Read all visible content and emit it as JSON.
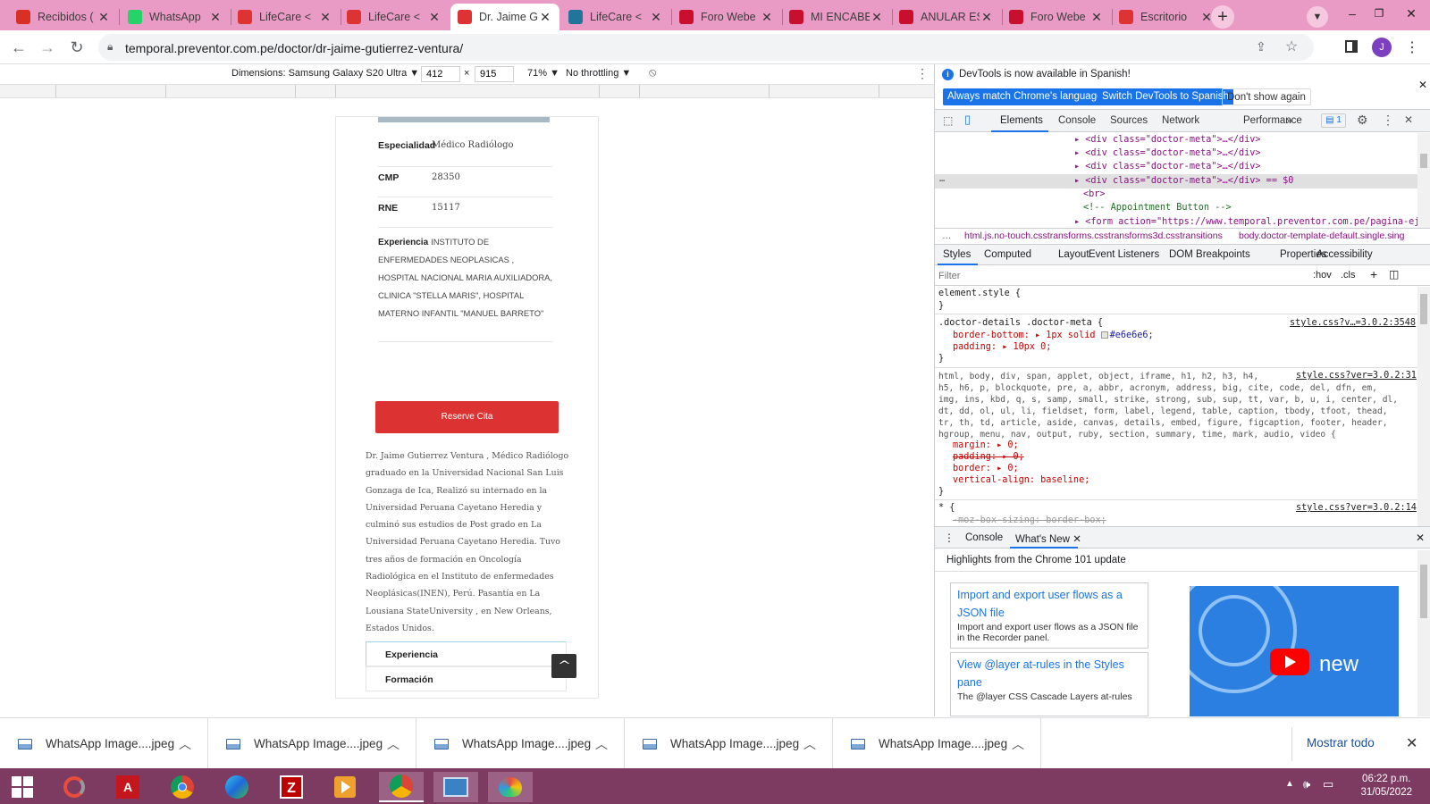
{
  "browser": {
    "tabs": [
      {
        "title": "Recibidos (",
        "favicon": "gmail-icon",
        "color": "#d93025"
      },
      {
        "title": "WhatsApp",
        "favicon": "whatsapp-icon",
        "color": "#25d366"
      },
      {
        "title": "LifeCare <",
        "favicon": "lifecare-icon",
        "color": "#d33"
      },
      {
        "title": "LifeCare <",
        "favicon": "lifecare-icon",
        "color": "#d33"
      },
      {
        "title": "Dr. Jaime G",
        "favicon": "lifecare-icon",
        "color": "#d33"
      },
      {
        "title": "LifeCare <",
        "favicon": "wordpress-icon",
        "color": "#21759b"
      },
      {
        "title": "Foro Webe",
        "favicon": "w-icon",
        "color": "#c8102e"
      },
      {
        "title": "MI ENCABE",
        "favicon": "w-icon",
        "color": "#c8102e"
      },
      {
        "title": "ANULAR ES",
        "favicon": "w-icon",
        "color": "#c8102e"
      },
      {
        "title": "Foro Webe",
        "favicon": "w-icon",
        "color": "#c8102e"
      },
      {
        "title": "Escritorio",
        "favicon": "lifecare-icon",
        "color": "#d33"
      }
    ],
    "url": "temporal.preventor.com.pe/doctor/dr-jaime-gutierrez-ventura/",
    "profile_initial": "J"
  },
  "device_toolbar": {
    "dimensions_label": "Dimensions: Samsung Galaxy S20 Ultra ▼",
    "width": "412",
    "times": "×",
    "height": "915",
    "zoom": "71% ▼",
    "throttling": "No throttling ▼"
  },
  "doctor_page": {
    "meta": [
      {
        "key": "Especialidad",
        "value": "Médico Radiólogo"
      },
      {
        "key": "CMP",
        "value": "28350"
      },
      {
        "key": "RNE",
        "value": "15117"
      }
    ],
    "experience_key": "Experiencia",
    "experience_value": "INSTITUTO DE ENFERMEDADES NEOPLASICAS , HOSPITAL NACIONAL MARIA AUXILIADORA, CLINICA \"STELLA MARIS\", HOSPITAL MATERNO INFANTIL \"MANUEL BARRETO\"",
    "reserve_button": "Reserve Cita",
    "bio": "Dr. Jaime Gutierrez Ventura , Médico Radiólogo graduado en la Universidad Nacional San Luis Gonzaga de Ica, Realizó su internado en la Universidad Peruana Cayetano Heredia y culminó sus estudios de Post grado en La Universidad Peruana Cayetano Heredia. Tuvo tres años de formación en Oncología Radiológica en el Instituto de enfermedades Neoplásicas(INEN), Perú. Pasantía en La Lousiana StateUniversity , en New Orleans, Estados Unidos.",
    "accordion": [
      "Experiencia",
      "Formación"
    ],
    "back_to_top": "^"
  },
  "devtools": {
    "notice": "DevTools is now available in Spanish!",
    "btn_match": "Always match Chrome's language",
    "btn_switch": "Switch DevTools to Spanish",
    "btn_dont": "Don't show again",
    "main_tabs": [
      "Elements",
      "Console",
      "Sources",
      "Network",
      "Performance"
    ],
    "issues_count": "1",
    "dom_lines": [
      "<div class=\"doctor-meta\">…</div>",
      "<div class=\"doctor-meta\">…</div>",
      "<div class=\"doctor-meta\">…</div>",
      "<div class=\"doctor-meta\">…</div> == $0",
      "<br>",
      "<!-- Appointment Button -->",
      "<form action=\"https://www.temporal.preventor.com.pe/pagina-eje"
    ],
    "breadcrumb_1": "html.js.no-touch.csstransforms.csstransforms3d.csstransitions",
    "breadcrumb_2": "body.doctor-template-default.single.sing",
    "style_tabs": [
      "Styles",
      "Computed",
      "Layout",
      "Event Listeners",
      "DOM Breakpoints",
      "Properties",
      "Accessibility"
    ],
    "filter_placeholder": "Filter",
    "hov": ":hov",
    "cls": ".cls",
    "rule_element": "element.style {",
    "rule1_selector": ".doctor-details .doctor-meta {",
    "rule1_source": "style.css?v…=3.0.2:3548",
    "rule1_p1": "border-bottom: ▸ 1px solid ",
    "rule1_p1_color": "#e6e6e6;",
    "rule1_p2": "padding: ▸ 10px 0;",
    "rule2_source": "style.css?ver=3.0.2:31",
    "rule2_selector": "html, body, div, span, applet, object, iframe, h1, h2, h3, h4,\nh5, h6, p, blockquote, pre, a, abbr, acronym, address, big, cite, code, del, dfn, em,\nimg, ins, kbd, q, s, samp, small, strike, strong, sub, sup, tt, var, b, u, i, center, dl,\ndt, dd, ol, ul, li, fieldset, form, label, legend, table, caption, tbody, tfoot, thead,\ntr, th, td, article, aside, canvas, details, embed, figure, figcaption, footer, header,\nhgroup, menu, nav, output, ruby, section, summary, time, mark, audio, video {",
    "rule2_p1": "margin: ▸ 0;",
    "rule2_p2": "padding: ▸ 0;",
    "rule2_p3": "border: ▸ 0;",
    "rule2_p4": "vertical-align: baseline;",
    "rule3_selector": "* {",
    "rule3_source": "style.css?ver=3.0.2:14",
    "rule3_p1": "-moz-box-sizing: border-box;",
    "drawer_tabs": [
      "Console",
      "What's New"
    ],
    "whats_new_title": "Highlights from the Chrome 101 update",
    "news": [
      {
        "title": "Import and export user flows as a JSON file",
        "desc": "Import and export user flows as a JSON file in the Recorder panel."
      },
      {
        "title": "View @layer at-rules in the Styles pane",
        "desc": "The @layer CSS Cascade Layers at-rules"
      }
    ],
    "video_text": "new"
  },
  "downloads": {
    "items": [
      "WhatsApp Image....jpeg",
      "WhatsApp Image....jpeg",
      "WhatsApp Image....jpeg",
      "WhatsApp Image....jpeg",
      "WhatsApp Image....jpeg"
    ],
    "show_all": "Mostrar todo"
  },
  "taskbar": {
    "time": "06:22 p.m.",
    "date": "31/05/2022"
  }
}
